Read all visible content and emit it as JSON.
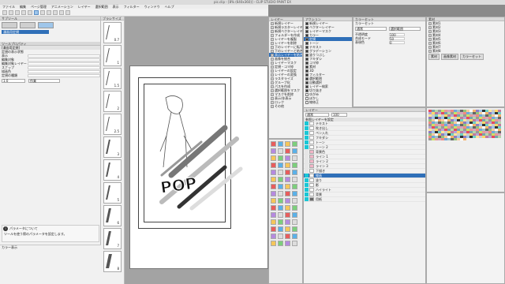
{
  "app": {
    "title": "pic.clip - [8% (640x360)] - CLIP STUDIO PAINT EX"
  },
  "menu": [
    "ファイル",
    "編集",
    "ページ管理",
    "アニメーション",
    "レイヤー",
    "選択範囲",
    "表示",
    "フィルター",
    "ウィンドウ",
    "ヘルプ"
  ],
  "sub_tool": {
    "header": "サブツール",
    "tab": "漫画用定規",
    "items": [
      "漫画用定規",
      "漫画用定規(キャンバス端に)"
    ]
  },
  "tool_property": {
    "header": "ツールプロパティ",
    "title": "[漫画用定規]",
    "note": "定規の表示状態",
    "rows": [
      {
        "label": "表示",
        "value": ""
      },
      {
        "label": "編集対象",
        "value": ""
      },
      {
        "label": "編集対象レイヤー",
        "value": ""
      },
      {
        "label": "スナップ",
        "value": ""
      },
      {
        "label": "描画色",
        "value": ""
      },
      {
        "label": "定規の種類",
        "value": ""
      }
    ],
    "selects": [
      "作業"
    ],
    "fields": [
      "1.0"
    ]
  },
  "help_panel": {
    "icon": "i",
    "title": "パラメータについて",
    "text": "ツールを使う際のパラメータを設定します。"
  },
  "left_bottom": {
    "label": "カラー表示"
  },
  "brush_panel": {
    "header": "ブラシサイズ",
    "items": [
      "0.7",
      "1",
      "1.5",
      "2",
      "2.5",
      "3",
      "4",
      "5",
      "6",
      "7",
      "8"
    ]
  },
  "canvas": {
    "art_text": "POP"
  },
  "menu_popup": {
    "header": "レイヤー",
    "items": [
      "新規レイヤー",
      "新規ラスターレイヤー",
      "新規ベクターレイヤー",
      "フォルダーを作成",
      "レイヤーを複製",
      "レイヤーを削除",
      "下のレイヤーに転写",
      "下のレイヤーと結合",
      "表示レイヤーを結合",
      "画像を統合",
      "レイヤーマスク",
      "定規・コマ枠",
      "レイヤーの設定",
      "レイヤーの変換",
      "ラスタライズ",
      "グループ化",
      "パスを作成",
      "選択範囲をマスク",
      "マスクを削除",
      "表示/非表示",
      "ロック",
      "その他"
    ]
  },
  "check_menu": {
    "header": "アクション",
    "items": [
      "新規レイヤー",
      "ベクターレイヤー",
      "レイヤーマスク",
      "カラー",
      "定規",
      "トーン",
      "テキスト",
      "グラデーション",
      "塗りつぶし",
      "フキダシ",
      "コマ枠",
      "素材",
      "3D",
      "フィルター",
      "選択範囲",
      "自動選択",
      "レイヤー検索",
      "切り抜き",
      "ゆがみ",
      "ぼかし",
      "線修正"
    ]
  },
  "sub_color": {
    "header": "カラーセット",
    "label": "カラーセット",
    "dropdowns": [
      "通常",
      "選択範囲"
    ],
    "lines": [
      "不透明度",
      "合成モード",
      "表現色"
    ],
    "values": [
      "100",
      "50",
      "0"
    ]
  },
  "material": {
    "header": "素材",
    "rows": [
      "素材1",
      "素材2",
      "素材3",
      "素材4",
      "素材5",
      "素材6",
      "素材7",
      "素材8"
    ],
    "tabs": [
      "素材",
      "画像素材",
      "カラーセット"
    ]
  },
  "layer": {
    "header": "レイヤー",
    "mode": "通常",
    "opacity": "100",
    "toggle": "参照レイヤーを設定",
    "layers": [
      {
        "name": "テキスト",
        "vis": true,
        "type": "normal"
      },
      {
        "name": "吹き出し",
        "vis": true,
        "type": "normal"
      },
      {
        "name": "ペン入れ",
        "vis": true,
        "type": "normal"
      },
      {
        "name": "フキダシ",
        "vis": true,
        "type": "normal"
      },
      {
        "name": "トーン",
        "vis": true,
        "type": "normal"
      },
      {
        "name": "トーン 2",
        "vis": true,
        "type": "normal"
      },
      {
        "name": "背景色",
        "vis": false,
        "type": "pink"
      },
      {
        "name": "ライン 1",
        "vis": false,
        "type": "pink"
      },
      {
        "name": "ライン 2",
        "vis": false,
        "type": "pink"
      },
      {
        "name": "ライン 3",
        "vis": false,
        "type": "pink"
      },
      {
        "name": "下描き",
        "vis": false,
        "type": "normal"
      },
      {
        "name": "線画",
        "vis": true,
        "type": "normal"
      },
      {
        "name": "塗り",
        "vis": true,
        "type": "normal"
      },
      {
        "name": "影",
        "vis": true,
        "type": "normal"
      },
      {
        "name": "ハイライト",
        "vis": true,
        "type": "normal"
      },
      {
        "name": "背景",
        "vis": true,
        "type": "normal"
      },
      {
        "name": "用紙",
        "vis": true,
        "type": "dark"
      }
    ]
  },
  "colors": {
    "accent": "#19c7d6",
    "selection": "#2f6fb8"
  }
}
